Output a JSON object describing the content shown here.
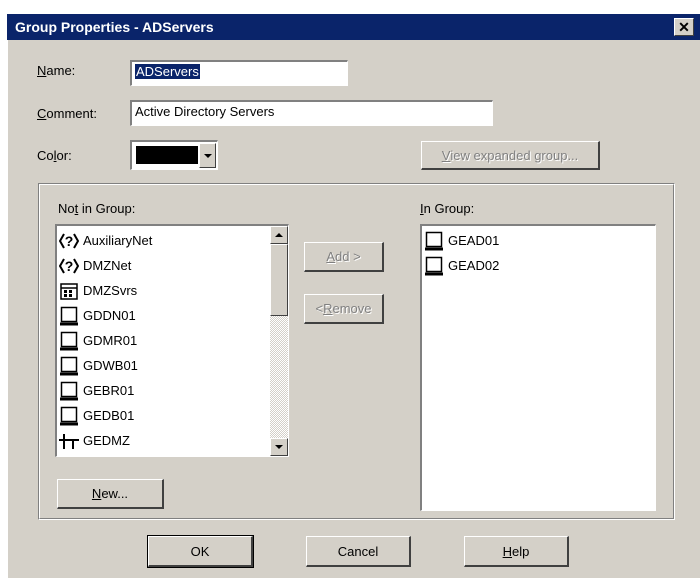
{
  "window": {
    "title": "Group Properties - ADServers",
    "close_glyph": "✕"
  },
  "form": {
    "name_label": "Name:",
    "name_value": "ADServers",
    "comment_label": "Comment:",
    "comment_value": "Active Directory Servers",
    "color_label": "Color:",
    "color_value": "#000000",
    "view_expanded_label": "View expanded group..."
  },
  "not_in_group": {
    "label": "Not in Group:",
    "items": [
      {
        "label": "AuxiliaryNet",
        "icon": "network-question-icon"
      },
      {
        "label": "DMZNet",
        "icon": "network-question-icon"
      },
      {
        "label": "DMZSvrs",
        "icon": "address-range-icon"
      },
      {
        "label": "GDDN01",
        "icon": "workstation-icon"
      },
      {
        "label": "GDMR01",
        "icon": "workstation-icon"
      },
      {
        "label": "GDWB01",
        "icon": "workstation-icon"
      },
      {
        "label": "GEBR01",
        "icon": "workstation-icon"
      },
      {
        "label": "GEDB01",
        "icon": "workstation-icon"
      },
      {
        "label": "GEDMZ",
        "icon": "network-icon"
      }
    ]
  },
  "in_group": {
    "label": "In Group:",
    "items": [
      {
        "label": "GEAD01",
        "icon": "workstation-icon"
      },
      {
        "label": "GEAD02",
        "icon": "workstation-icon"
      }
    ]
  },
  "buttons": {
    "add": "Add >",
    "remove": "< Remove",
    "new": "New...",
    "ok": "OK",
    "cancel": "Cancel",
    "help": "Help"
  }
}
